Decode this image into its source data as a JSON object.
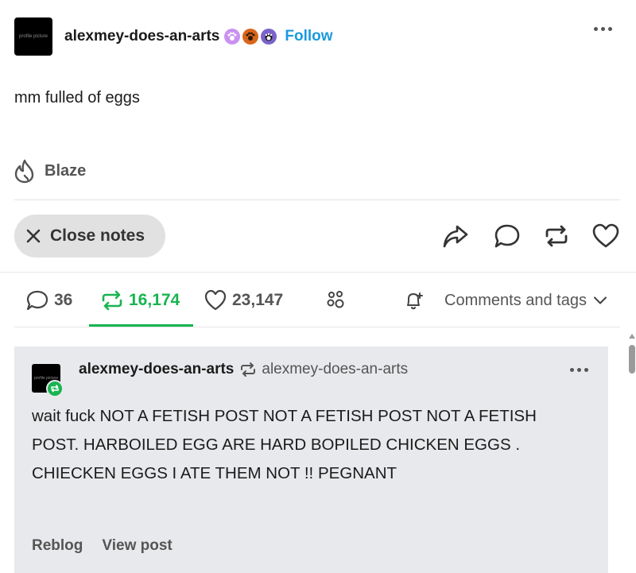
{
  "post": {
    "avatar_text": "profile picture",
    "blog_name": "alexmey-does-an-arts",
    "badges": [
      "paw-badge-pink",
      "paw-badge-orange",
      "paw-badge-dark"
    ],
    "follow_label": "Follow",
    "body_text": "mm fulled of eggs",
    "blaze_label": "Blaze"
  },
  "actions": {
    "close_notes_label": "Close notes",
    "share_icon": "share-icon",
    "reply_icon": "reply-icon",
    "reblog_icon": "reblog-icon",
    "like_icon": "heart-icon"
  },
  "notes_tabs": {
    "replies_count": "36",
    "reblogs_count": "16,174",
    "likes_count": "23,147",
    "comments_tags_label": "Comments and tags"
  },
  "reblog_card": {
    "avatar_text": "profile picture",
    "blog_name": "alexmey-does-an-arts",
    "source_blog": "alexmey-does-an-arts",
    "text": "wait fuck NOT A FETISH POST NOT A FETISH POST NOT A FETISH POST. HARBOILED EGG ARE HARD BOPILED CHICKEN EGGS . CHIECKEN EGGS I ATE THEM NOT !! PEGNANT",
    "reblog_label": "Reblog",
    "view_post_label": "View post"
  },
  "colors": {
    "accent_blue": "#1a9ae0",
    "accent_green": "#18b450",
    "card_bg": "#e8e9ec"
  }
}
